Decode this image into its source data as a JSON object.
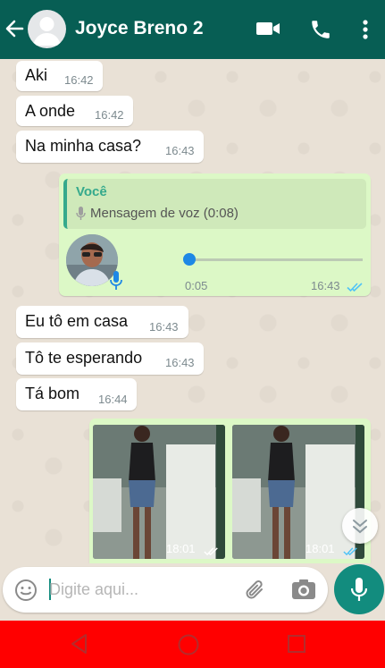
{
  "header": {
    "contact_name": "Joyce Breno 2",
    "icons": [
      "back-arrow-icon",
      "default-avatar-icon",
      "video-call-icon",
      "phone-icon",
      "more-options-icon"
    ],
    "background_color": "#075e54"
  },
  "messages": [
    {
      "text": "Aki",
      "time": "16:42",
      "direction": "incoming"
    },
    {
      "text": "A onde",
      "time": "16:42",
      "direction": "incoming"
    },
    {
      "text": "Na minha casa?",
      "time": "16:43",
      "direction": "incoming"
    },
    {
      "type": "voice",
      "direction": "outgoing",
      "quoted_author": "Você",
      "quoted_text": "Mensagem de voz (0:08)",
      "elapsed": "0:05",
      "time": "16:43",
      "progress": 0.0,
      "read": true
    },
    {
      "text": "Eu tô em casa",
      "time": "16:43",
      "direction": "incoming"
    },
    {
      "text": "Tô te esperando",
      "time": "16:43",
      "direction": "incoming"
    },
    {
      "text": "Tá bom",
      "time": "16:44",
      "direction": "incoming"
    },
    {
      "type": "images",
      "direction": "outgoing",
      "photos": [
        {
          "time": "18:01"
        },
        {
          "time": "18:01"
        }
      ]
    }
  ],
  "composer": {
    "placeholder": "Digite aqui..."
  },
  "colors": {
    "incoming_bubble": "#ffffff",
    "outgoing_bubble": "#dcf8c6",
    "accent": "#128c7e",
    "read_ticks": "#4fc3f7",
    "nav_bar": "#ff0000"
  }
}
